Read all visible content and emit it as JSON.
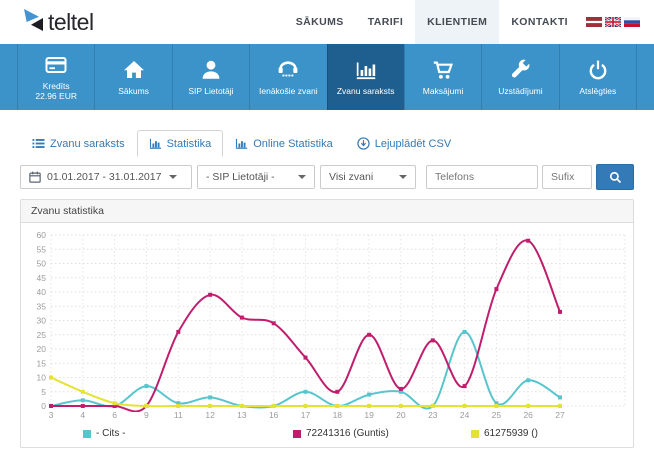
{
  "header": {
    "logo": {
      "text": "teltel"
    },
    "nav": {
      "items": [
        {
          "label": "SĀKUMS"
        },
        {
          "label": "TARIFI"
        },
        {
          "label": "KLIENTIEM",
          "active": true
        },
        {
          "label": "KONTAKTI"
        }
      ]
    },
    "flags": [
      {
        "name": "latvia-flag"
      },
      {
        "name": "uk-flag"
      },
      {
        "name": "russia-flag"
      }
    ]
  },
  "toolbar": {
    "items": [
      {
        "label": "Kredīts",
        "label2": "22.96 EUR",
        "icon": "credit-card-icon"
      },
      {
        "label": "Sākums",
        "icon": "home-icon"
      },
      {
        "label": "SIP Lietotāji",
        "icon": "user-icon"
      },
      {
        "label": "Ienākošie zvani",
        "icon": "phone-icon"
      },
      {
        "label": "Zvanu saraksts",
        "icon": "bar-chart-icon",
        "active": true
      },
      {
        "label": "Maksājumi",
        "icon": "cart-icon"
      },
      {
        "label": "Uzstādījumi",
        "icon": "wrench-icon"
      },
      {
        "label": "Atslēgties",
        "icon": "power-icon"
      }
    ]
  },
  "tabs": {
    "items": [
      {
        "label": "Zvanu saraksts",
        "icon": "list-icon"
      },
      {
        "label": "Statistika",
        "icon": "chart-icon",
        "active": true
      },
      {
        "label": "Online Statistika",
        "icon": "chart-icon"
      },
      {
        "label": "Lejuplādēt CSV",
        "icon": "download-icon"
      }
    ]
  },
  "filters": {
    "date_range": "01.01.2017 - 31.01.2017",
    "sip_select": "- SIP Lietotāji -",
    "calls_select": "Visi zvani",
    "phone_placeholder": "Telefons",
    "suffix_placeholder": "Sufix"
  },
  "panel": {
    "title": "Zvanu statistika"
  },
  "chart_data": {
    "type": "line",
    "title": "Zvanu statistika",
    "xlabel": "",
    "ylabel": "",
    "categories": [
      "3",
      "4",
      "6",
      "9",
      "11",
      "12",
      "13",
      "16",
      "17",
      "18",
      "19",
      "20",
      "23",
      "24",
      "25",
      "26",
      "27"
    ],
    "series": [
      {
        "name": "- Cits -",
        "color": "#58c5cd",
        "values": [
          0,
          2,
          0,
          7,
          1,
          3,
          0,
          0,
          5,
          0,
          4,
          5,
          0,
          26,
          1,
          9,
          3
        ]
      },
      {
        "name": "72241316 (Guntis)",
        "color": "#c01d6d",
        "values": [
          0,
          0,
          0,
          0,
          26,
          39,
          31,
          29,
          17,
          5,
          25,
          6,
          23,
          7,
          41,
          58,
          33
        ]
      },
      {
        "name": "61275939 ()",
        "color": "#e4e233",
        "values": [
          10,
          5,
          1,
          0,
          0,
          0,
          0,
          0,
          0,
          0,
          0,
          0,
          0,
          0,
          0,
          0,
          0
        ]
      }
    ],
    "ylim": [
      0,
      60
    ],
    "ytick_step": 5,
    "grid": true,
    "grid_style": "dotted",
    "marker": "square",
    "legend_position": "bottom"
  },
  "colors": {
    "toolbar_blue": "#3b93c9",
    "toolbar_active_blue": "#1f5f90",
    "link_blue": "#337ab7",
    "axis_text": "#9b9b9b"
  }
}
